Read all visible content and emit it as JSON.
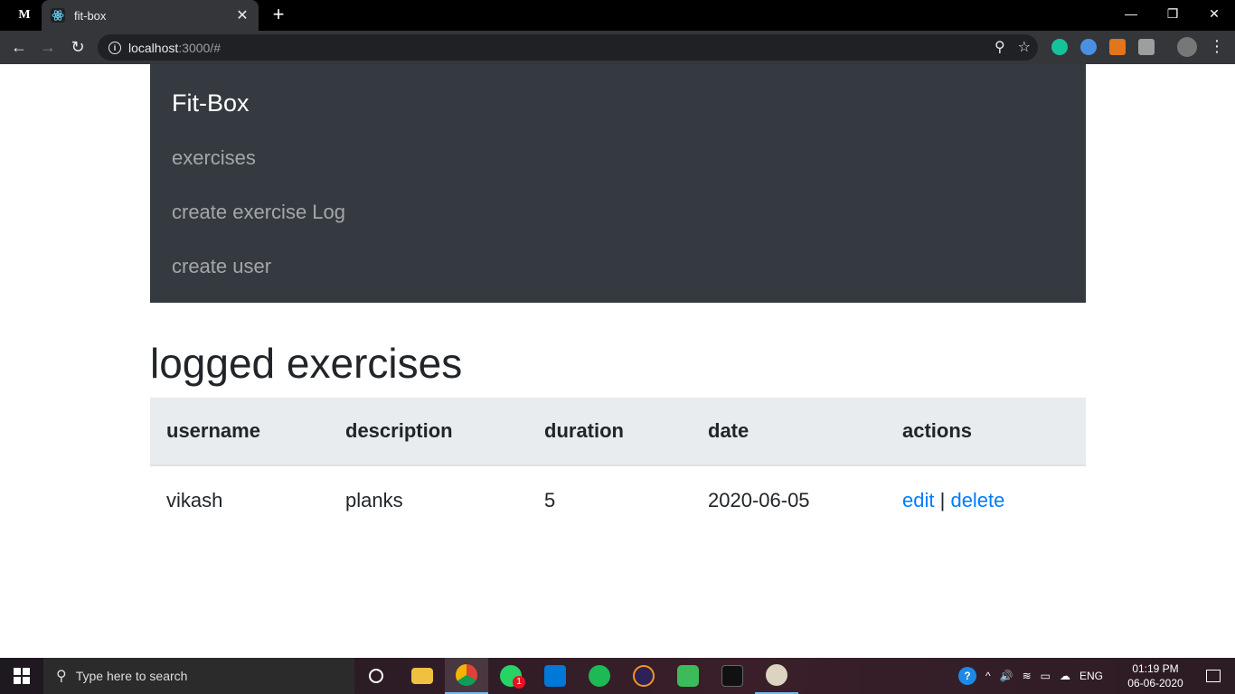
{
  "browser": {
    "pinned_tab_label": "M",
    "tab_title": "fit-box",
    "url_host": "localhost",
    "url_rest": ":3000/#"
  },
  "navbar": {
    "brand": "Fit-Box",
    "links": [
      "exercises",
      "create exercise Log",
      "create user"
    ]
  },
  "main": {
    "heading": "logged exercises",
    "table": {
      "headers": [
        "username",
        "description",
        "duration",
        "date",
        "actions"
      ],
      "rows": [
        {
          "username": "vikash",
          "description": "planks",
          "duration": "5",
          "date": "2020-06-05",
          "edit": "edit",
          "separator": "|",
          "delete": "delete"
        }
      ]
    }
  },
  "taskbar": {
    "search_placeholder": "Type here to search",
    "whatsapp_badge": "1",
    "lang": "ENG",
    "time": "01:19 PM",
    "date": "06-06-2020"
  },
  "colors": {
    "navbar_bg": "#343a40",
    "link": "#007bff",
    "table_head_bg": "#e9ecef"
  }
}
